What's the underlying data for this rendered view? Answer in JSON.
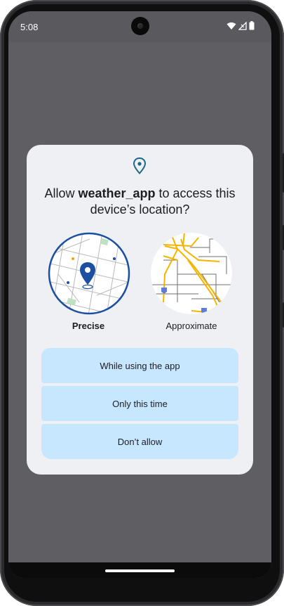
{
  "status_bar": {
    "time": "5:08",
    "icons": [
      "wifi-icon",
      "signal-icon",
      "battery-icon"
    ]
  },
  "dialog": {
    "icon": "location-pin-icon",
    "title_prefix": "Allow ",
    "app_name": "weather_app",
    "title_suffix": " to access this device’s location?",
    "options": {
      "precise_label": "Precise",
      "approximate_label": "Approximate",
      "selected": "Precise"
    },
    "buttons": {
      "while_using": "While using the app",
      "only_this_time": "Only this time",
      "dont_allow": "Don’t allow"
    }
  },
  "colors": {
    "scrim": "#5f5e62",
    "dialog_bg": "#eff0f4",
    "button_bg": "#c6e7ff",
    "accent_blue": "#1d4fa0",
    "map_roads_yellow": "#f4b400",
    "icon_teal": "#1a6a85"
  }
}
